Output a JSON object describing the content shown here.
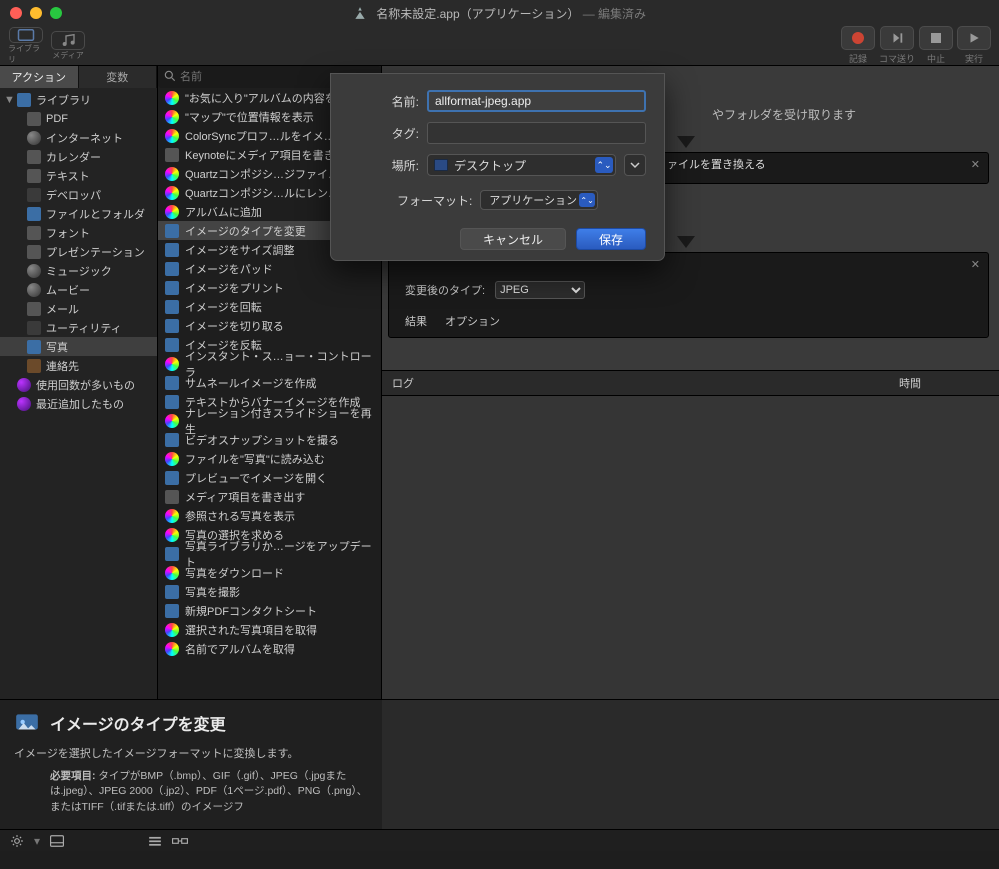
{
  "window": {
    "title_main": "名称未設定.app（アプリケーション）",
    "title_edited": " — 編集済み"
  },
  "toolbar": {
    "left": [
      {
        "name": "library-mode",
        "label": "ライブラリ",
        "icon": "rect-icon"
      },
      {
        "name": "media-mode",
        "label": "メディア",
        "icon": "music-icon"
      }
    ],
    "right": [
      {
        "name": "record-btn",
        "label": "記録",
        "icon": "record-icon"
      },
      {
        "name": "step-btn",
        "label": "コマ送り",
        "icon": "step-icon"
      },
      {
        "name": "stop-btn",
        "label": "中止",
        "icon": "stop-icon"
      },
      {
        "name": "run-btn",
        "label": "実行",
        "icon": "play-icon"
      }
    ]
  },
  "leftTabs": {
    "active": "アクション",
    "other": "変数"
  },
  "search": {
    "placeholder": "名前"
  },
  "library": {
    "root": "ライブラリ",
    "items": [
      {
        "label": "PDF",
        "icon": "pdf"
      },
      {
        "label": "インターネット",
        "icon": "globe"
      },
      {
        "label": "カレンダー",
        "icon": "calendar"
      },
      {
        "label": "テキスト",
        "icon": "text"
      },
      {
        "label": "デベロッパ",
        "icon": "dev"
      },
      {
        "label": "ファイルとフォルダ",
        "icon": "folder"
      },
      {
        "label": "フォント",
        "icon": "font"
      },
      {
        "label": "プレゼンテーション",
        "icon": "pres"
      },
      {
        "label": "ミュージック",
        "icon": "music"
      },
      {
        "label": "ムービー",
        "icon": "movie"
      },
      {
        "label": "メール",
        "icon": "mail"
      },
      {
        "label": "ユーティリティ",
        "icon": "util"
      },
      {
        "label": "写真",
        "icon": "photos",
        "selected": true
      },
      {
        "label": "連絡先",
        "icon": "contacts"
      }
    ],
    "footer": [
      {
        "label": "使用回数が多いもの",
        "icon": "purple"
      },
      {
        "label": "最近追加したもの",
        "icon": "purple"
      }
    ]
  },
  "actions": [
    "\"お気に入り\"アルバムの内容を…",
    "\"マップ\"で位置情報を表示",
    "ColorSyncプロフ…ルをイメ…",
    "Keynoteにメディア項目を書き…",
    "Quartzコンポジシ…ジファイ…",
    "Quartzコンポジシ…ルにレン…",
    "アルバムに追加",
    "イメージのタイプを変更",
    "イメージをサイズ調整",
    "イメージをパッド",
    "イメージをプリント",
    "イメージを回転",
    "イメージを切り取る",
    "イメージを反転",
    "インスタント・ス…ョー・コントローラ",
    "サムネールイメージを作成",
    "テキストからバナーイメージを作成",
    "ナレーション付きスライドショーを再生",
    "ビデオスナップショットを撮る",
    "ファイルを\"写真\"に読み込む",
    "プレビューでイメージを開く",
    "メディア項目を書き出す",
    "参照される写真を表示",
    "写真の選択を求める",
    "写真ライブラリか…ージをアップデート",
    "写真をダウンロード",
    "写真を撮影",
    "新規PDFコンタクトシート",
    "選択された写真項目を取得",
    "名前でアルバムを取得"
  ],
  "actionsSelectedIndex": 7,
  "actionIcons": [
    "col",
    "col",
    "col",
    "sq",
    "col",
    "col",
    "col",
    "sqb",
    "sqb",
    "sqb",
    "sqb",
    "sqb",
    "sqb",
    "sqb",
    "col",
    "sqb",
    "sqb",
    "col",
    "sqb",
    "col",
    "sqb",
    "sq",
    "col",
    "col",
    "sqb",
    "col",
    "sqb",
    "sqb",
    "col",
    "col"
  ],
  "workflow": {
    "hint": "やフォルダを受け取ります",
    "card1": {
      "title_fragment": "ァイルを置き換える"
    },
    "card2": {
      "type_label": "変更後のタイプ:",
      "type_value": "JPEG",
      "footer": [
        "結果",
        "オプション"
      ]
    },
    "log": {
      "col1": "ログ",
      "col2": "時間"
    }
  },
  "description": {
    "title": "イメージのタイプを変更",
    "summary": "イメージを選択したイメージフォーマットに変換します。",
    "need_label": "必要項目:",
    "need_body": "タイプがBMP（.bmp）、GIF（.gif）、JPEG（.jpgまたは.jpeg）、JPEG 2000（.jp2）、PDF（1ページ.pdf）、PNG（.png）、またはTIFF（.tifまたは.tiff）のイメージフ"
  },
  "saveSheet": {
    "name_label": "名前:",
    "name_value": "allformat-jpeg.app",
    "tag_label": "タグ:",
    "location_label": "場所:",
    "location_value": "デスクトップ",
    "format_label": "フォーマット:",
    "format_value": "アプリケーション",
    "cancel": "キャンセル",
    "save": "保存"
  }
}
